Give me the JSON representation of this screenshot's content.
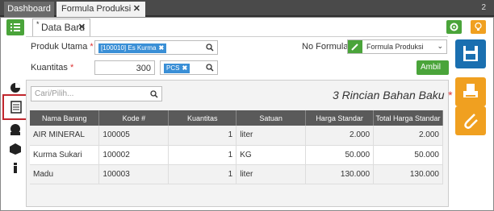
{
  "tabs": [
    {
      "label": "Dashboard"
    },
    {
      "label": "Formula Produksi"
    }
  ],
  "tab_count": "2",
  "document_tab": {
    "label": "Data Baru"
  },
  "form": {
    "produk_utama": {
      "label": "Produk Utama",
      "chip": "[100010] Es Kurma"
    },
    "kuantitas": {
      "label": "Kuantitas",
      "value": "300",
      "unit_chip": "PCS"
    },
    "no_formula": {
      "label": "No Formula #",
      "selected": "Formula Produksi"
    },
    "ambil_label": "Ambil"
  },
  "search": {
    "placeholder": "Cari/Pilih..."
  },
  "rincian": {
    "title": "3 Rincian Bahan Baku"
  },
  "table": {
    "headers": [
      "Nama Barang",
      "Kode #",
      "Kuantitas",
      "Satuan",
      "Harga Standar",
      "Total Harga Standar"
    ],
    "rows": [
      {
        "nama": "AIR MINERAL",
        "kode": "100005",
        "kuantitas": "1",
        "satuan": "liter",
        "harga": "2.000",
        "total": "2.000"
      },
      {
        "nama": "Kurma Sukari",
        "kode": "100002",
        "kuantitas": "1",
        "satuan": "KG",
        "harga": "50.000",
        "total": "50.000"
      },
      {
        "nama": "Madu",
        "kode": "100003",
        "kuantitas": "1",
        "satuan": "liter",
        "harga": "130.000",
        "total": "130.000"
      }
    ]
  },
  "icons": [
    "list-icon",
    "gear-icon",
    "lightbulb-icon",
    "save-icon",
    "print-icon",
    "attach-icon",
    "chart-icon",
    "document-icon",
    "bill-icon",
    "box-icon",
    "info-icon"
  ],
  "colors": {
    "green": "#4aa43a",
    "orange": "#f0a020",
    "blue": "#1a6fb0",
    "chip": "#3a8fd6",
    "header": "#5a5a5a",
    "highlight": "#c0262d"
  }
}
